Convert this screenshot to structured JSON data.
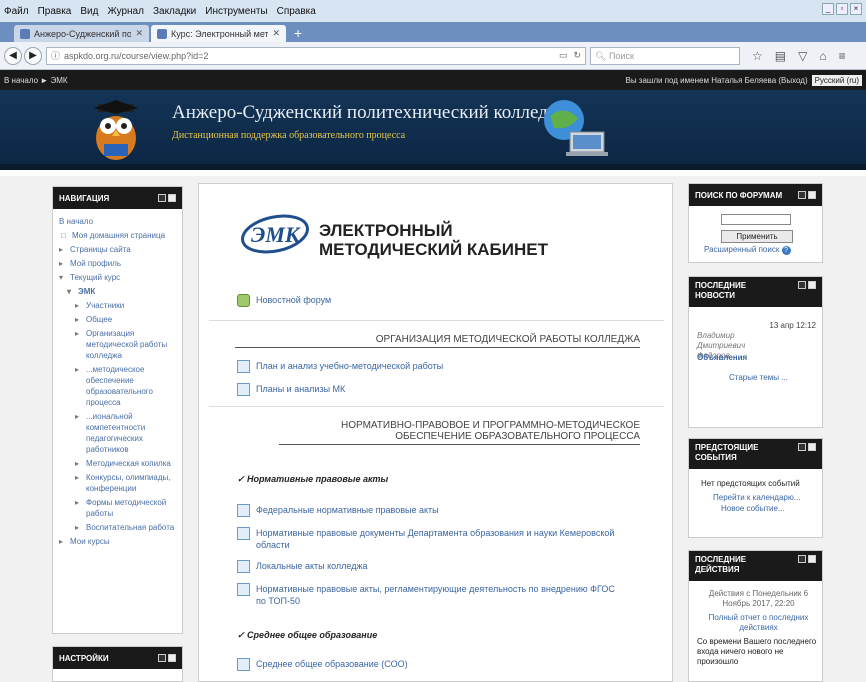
{
  "browser": {
    "menu": [
      "Файл",
      "Правка",
      "Вид",
      "Журнал",
      "Закладки",
      "Инструменты",
      "Справка"
    ],
    "tabs": [
      {
        "label": "Анжеро-Судженский полит..."
      },
      {
        "label": "Курс: Электронный методи..."
      }
    ],
    "url": "aspkdo.org.ru/course/view.php?id=2",
    "search_placeholder": "Поиск"
  },
  "site": {
    "breadcrumb": "В начало ► ЭМК",
    "login_info": "Вы зашли под именем Наталья Беляева (Выход)",
    "language": "Русский (ru)",
    "title": "Анжеро-Судженский политехнический колледж",
    "subtitle": "Дистанционная поддержка образовательного процесса"
  },
  "navigation": {
    "header": "НАВИГАЦИЯ",
    "home": "В начало",
    "items": [
      "Моя домашняя страница",
      "Страницы сайта",
      "Мой профиль",
      "Текущий курс",
      "ЭМК",
      "Участники",
      "Общее",
      "Организация методической работы колледжа",
      "...методическое обеспечение образовательного процесса",
      "...иональной компетентности педагогических работников",
      "Методическая копилка",
      "Конкурсы, олимпиады, конференции",
      "Формы методической работы",
      "Воспитательная работа",
      "Мои курсы"
    ]
  },
  "settings": {
    "header": "НАСТРОЙКИ"
  },
  "main": {
    "course_title": "ЭЛЕКТРОННЫЙ МЕТОДИЧЕСКИЙ КАБИНЕТ",
    "logo_text": "ЭМК",
    "news_forum": "Новостной форум",
    "section1": "ОРГАНИЗАЦИЯ МЕТОДИЧЕСКОЙ РАБОТЫ КОЛЛЕДЖА",
    "s1_links": [
      "План и анализ учебно-методической работы",
      "Планы и анализы МК"
    ],
    "section2": "НОРМАТИВНО-ПРАВОВОЕ И ПРОГРАММНО-МЕТОДИЧЕСКОЕ ОБЕСПЕЧЕНИЕ ОБРАЗОВАТЕЛЬНОГО ПРОЦЕССА",
    "label1": "✓ Нормативные правовые акты",
    "s2_links": [
      "Федеральные нормативные правовые акты",
      "Нормативные правовые документы Департамента образования и науки Кемеровской области",
      "Локальные акты колледжа",
      "Нормативные правовые акты, регламентирующие деятельность по внедрению ФГОС по ТОП-50"
    ],
    "label2": "✓ Среднее общее образование",
    "s3_links": [
      "Среднее общее образование (СОО)"
    ]
  },
  "forum_search": {
    "header": "ПОИСК ПО ФОРУМАМ",
    "button": "Применить",
    "advanced": "Расширенный поиск"
  },
  "latest_news": {
    "header": "ПОСЛЕДНИЕ НОВОСТИ",
    "date": "13 апр 12:12",
    "author": "Владимир Дмитриевич Федоров",
    "title": "Объявления",
    "older": "Старые темы ..."
  },
  "upcoming": {
    "header": "ПРЕДСТОЯЩИЕ СОБЫТИЯ",
    "none": "Нет предстоящих событий",
    "calendar": "Перейти к календарю...",
    "new_event": "Новое событие..."
  },
  "recent": {
    "header": "ПОСЛЕДНИЕ ДЕЙСТВИЯ",
    "since": "Действия с Понедельник 6 Ноябрь 2017, 22:20",
    "report": "Полный отчет о последних действиях",
    "nothing": "Со времени Вашего последнего входа ничего нового не произошло"
  }
}
